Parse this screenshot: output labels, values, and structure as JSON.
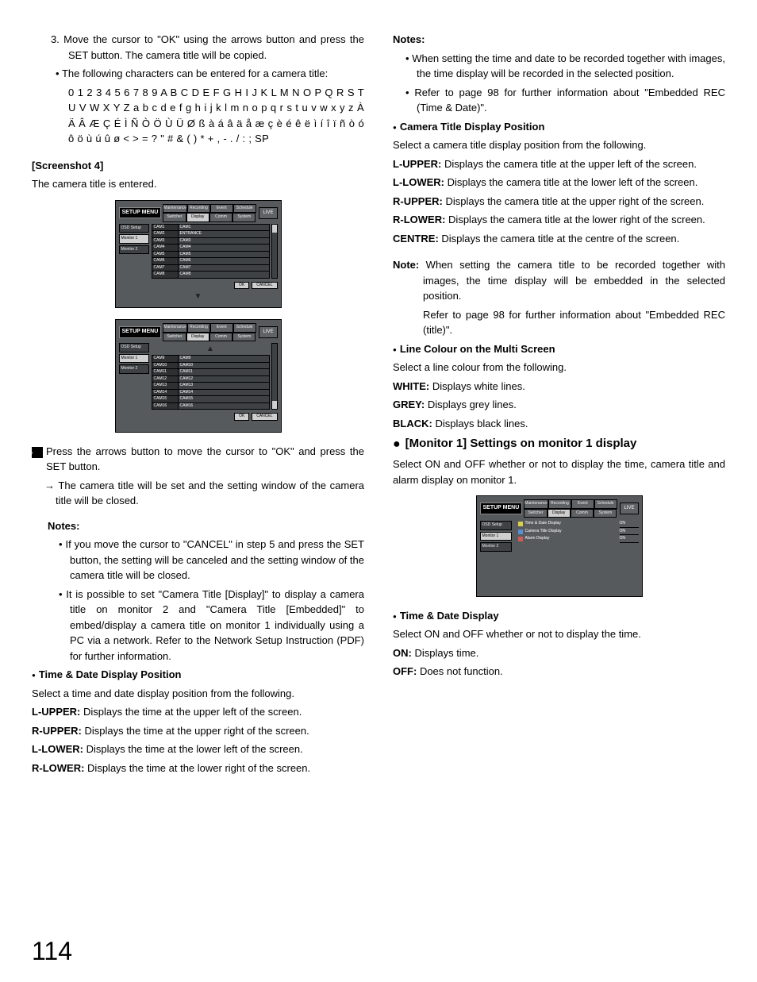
{
  "page_number": "114",
  "left": {
    "item3": "3. Move the cursor to \"OK\" using the arrows button and press the SET button. The camera title will be copied.",
    "bullet_chars_intro": "The following characters can be entered for a camera title:",
    "chars1": "0 1 2 3 4 5 6 7 8 9 A B C D E F G H I J K L M N O P Q R S T U V W X Y Z a b c d e f g h i j k l m n o p q r s t u v w x y z À Ä Â Æ Ç É Ì Ñ Ò Ö Ù Ü Ø ß à á â ä å æ ç è é ê ë ì í î ï ñ ò ó ô ö ù ú û ø < > = ? \" # & ( ) * + , - . / : ; SP",
    "ss4_label": "[Screenshot 4]",
    "ss4_caption": "The camera title is entered.",
    "step5": "Press the arrows button to move the cursor to \"OK\" and press the SET button.",
    "step5_arrow": "→ The camera title will be set and the setting window of the camera title will be closed.",
    "notes_label": "Notes:",
    "note_a": "If you move the cursor to \"CANCEL\" in step 5 and press the SET button, the setting will be canceled and the setting window of the camera title will be closed.",
    "note_b": "It is possible to set \"Camera Title [Display]\" to display a camera title on monitor 2 and \"Camera Title [Embedded]\" to embed/display a camera title on monitor 1 individually using a PC via a network. Refer to the Network Setup Instruction (PDF) for further information.",
    "tddp_title": "Time & Date Display Position",
    "tddp_intro": "Select a time and date display position from the following.",
    "tddp_lu": "Displays the time at the upper left of the screen.",
    "tddp_ru": "Displays the time at the upper right of the screen.",
    "tddp_ll": "Displays the time at the lower left of the screen.",
    "tddp_rl": "Displays the time at the lower right of the screen."
  },
  "right": {
    "notes_label": "Notes:",
    "note_a": "When setting the time and date to be recorded together with images, the time display will be recorded in the selected position.",
    "note_b": "Refer to page 98 for further information about \"Embedded REC (Time & Date)\".",
    "ctdp_title": "Camera Title Display Position",
    "ctdp_intro": "Select a camera title display position from the following.",
    "ctdp_lu": "Displays the camera title at the upper left of the screen.",
    "ctdp_ll": "Displays the camera title at the lower left of the screen.",
    "ctdp_ru": "Displays the camera title at the upper right of the screen.",
    "ctdp_rl": "Displays the camera title at the lower right of the screen.",
    "ctdp_c": "Displays the camera title at the centre of the screen.",
    "note2a": "When setting the camera title to be recorded together with images, the time display will be embedded in the selected position.",
    "note2b": "Refer to page 98 for further information about \"Embedded REC (title)\".",
    "line_title": "Line Colour on the Multi Screen",
    "line_intro": "Select a line colour from the following.",
    "line_w": "Displays white lines.",
    "line_g": "Displays grey lines.",
    "line_b": "Displays black lines.",
    "mon1_title": "[Monitor 1] Settings on monitor 1 display",
    "mon1_intro": "Select ON and OFF whether or not to display the time, camera title and alarm display on monitor 1.",
    "tdd_title": "Time & Date Display",
    "tdd_intro": "Select ON and OFF whether or not to display the time.",
    "tdd_on": "Displays time.",
    "tdd_off": "Does not function."
  },
  "ui": {
    "setup_menu": "SETUP MENU",
    "live": "LIVE",
    "tabs_top": [
      "Maintenance",
      "Recording",
      "Event",
      "Schedule"
    ],
    "tabs_bot": [
      "Switcher",
      "Display",
      "Comm",
      "System"
    ],
    "osd_setup": "OSD Setup",
    "monitor1": "Monitor 1",
    "monitor2": "Monitor 2",
    "ok": "OK",
    "cancel": "CANCEL",
    "cam_rows_a": [
      [
        "CAM1",
        "CAM1"
      ],
      [
        "CAM2",
        "ENTRANCE"
      ],
      [
        "CAM3",
        "CAM3"
      ],
      [
        "CAM4",
        "CAM4"
      ],
      [
        "CAM5",
        "CAM5"
      ],
      [
        "CAM6",
        "CAM6"
      ],
      [
        "CAM7",
        "CAM7"
      ],
      [
        "CAM8",
        "CAM8"
      ]
    ],
    "cam_rows_b": [
      [
        "CAM9",
        "CAM9"
      ],
      [
        "CAM10",
        "CAM10"
      ],
      [
        "CAM11",
        "CAM11"
      ],
      [
        "CAM12",
        "CAM12"
      ],
      [
        "CAM13",
        "CAM13"
      ],
      [
        "CAM14",
        "CAM14"
      ],
      [
        "CAM15",
        "CAM15"
      ],
      [
        "CAM16",
        "CAM16"
      ]
    ],
    "mon1_items": [
      {
        "label": "Time & Date Display",
        "value": "ON"
      },
      {
        "label": "Camera Title Display",
        "value": "ON"
      },
      {
        "label": "Alarm Display",
        "value": "ON"
      }
    ]
  }
}
